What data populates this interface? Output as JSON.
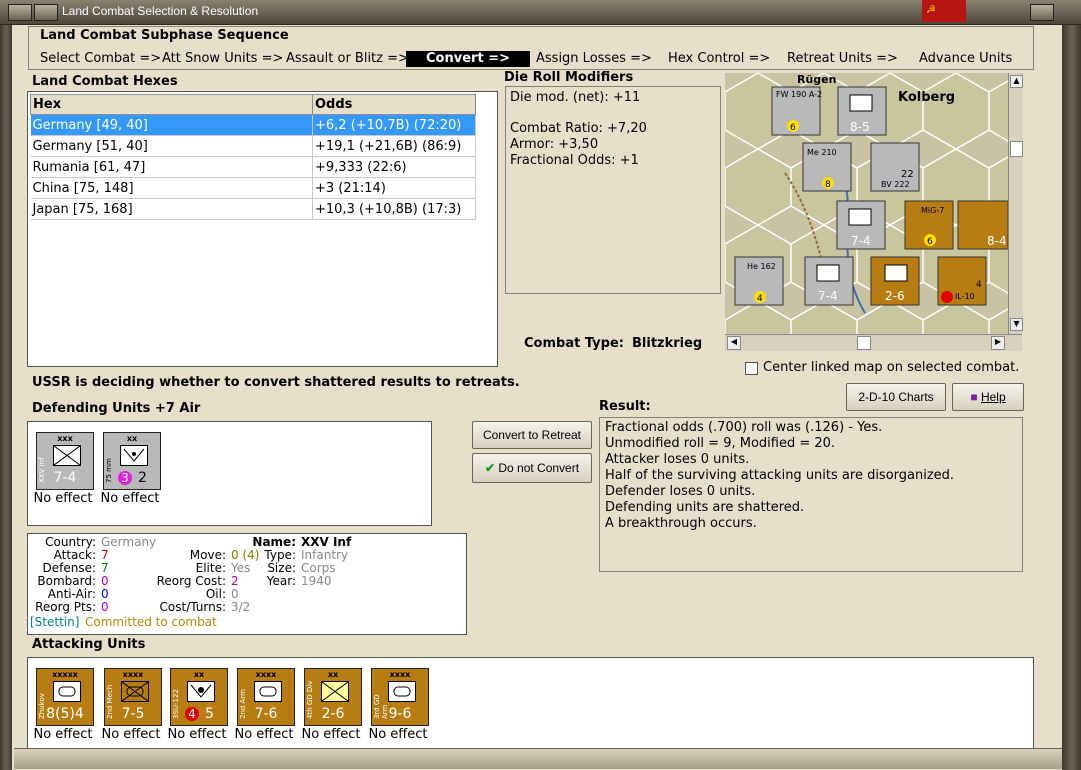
{
  "window": {
    "title": "Land Combat Selection & Resolution"
  },
  "sequence": {
    "title": "Land Combat Subphase Sequence",
    "items": [
      "Select Combat =>",
      "Att Snow Units =>",
      "Assault or Blitz =>",
      "Convert =>",
      "Assign Losses =>",
      "Hex Control =>",
      "Retreat Units =>",
      "Advance Units"
    ]
  },
  "hexes": {
    "title": "Land Combat Hexes",
    "columns": [
      "Hex",
      "Odds"
    ],
    "rows": [
      [
        "Germany [49, 40]",
        "+6,2 (+10,7B) (72:20)"
      ],
      [
        "Germany [51, 40]",
        "+19,1 (+21,6B) (86:9)"
      ],
      [
        "Rumania [61, 47]",
        "+9,333 (22:6)"
      ],
      [
        "China [75, 148]",
        "+3 (21:14)"
      ],
      [
        "Japan [75, 168]",
        "+10,3 (+10,8B) (17:3)"
      ]
    ]
  },
  "modifiers": {
    "title": "Die Roll Modifiers",
    "lines": [
      "Die mod. (net): +11",
      "",
      "Combat Ratio: +7,20",
      "Armor: +3,50",
      "Fractional Odds: +1"
    ]
  },
  "combat_type": {
    "label": "Combat Type:",
    "value": "Blitzkrieg"
  },
  "center_map_label": "Center linked map on selected combat.",
  "status_text": "USSR is deciding whether to convert shattered results to retreats.",
  "buttons": {
    "charts": "2-D-10 Charts",
    "help": "Help",
    "convert": "Convert to Retreat",
    "no_convert": "Do not Convert"
  },
  "defending": {
    "title": "Defending Units +7 Air",
    "units": [
      {
        "size": "xxx",
        "side": "XXV Inf",
        "strength": "7-4",
        "effect": "No effect"
      },
      {
        "size": "xx",
        "side": "75 mm",
        "strength_a": "3",
        "strength_b": "2",
        "effect": "No effect"
      }
    ]
  },
  "unit_info": {
    "country_label": "Country:",
    "country": "Germany",
    "attack_label": "Attack:",
    "attack": "7",
    "defense_label": "Defense:",
    "defense": "7",
    "bombard_label": "Bombard:",
    "bombard": "0",
    "antiair_label": "Anti-Air:",
    "antiair": "0",
    "reorg_pts_label": "Reorg Pts:",
    "reorg_pts": "0",
    "move_label": "Move:",
    "move": "0 (4)",
    "elite_label": "Elite:",
    "elite": "Yes",
    "reorg_cost_label": "Reorg Cost:",
    "reorg_cost": "2",
    "oil_label": "Oil:",
    "oil": "0",
    "cost_turns_label": "Cost/Turns:",
    "cost_turns": "3/2",
    "name_label": "Name:",
    "name": "XXV Inf",
    "type_label": "Type:",
    "type": "Infantry",
    "size_label": "Size:",
    "size": "Corps",
    "year_label": "Year:",
    "year": "1940",
    "location": "[Stettin]",
    "status": "Committed to combat"
  },
  "result": {
    "title": "Result:",
    "lines": [
      "Fractional odds (.700) roll was (.126)  - Yes.",
      "Unmodified roll = 9, Modified = 20.",
      "Attacker loses 0 units.",
      "Half of the surviving attacking units are disorganized.",
      "Defender loses 0 units.",
      "Defending units are shattered.",
      "A breakthrough occurs."
    ]
  },
  "attacking": {
    "title": "Attacking Units",
    "units": [
      {
        "size": "xxxxx",
        "side": "Zhukov",
        "strength": "8(5)4",
        "effect": "No effect"
      },
      {
        "size": "xxxx",
        "side": "2nd Mech",
        "strength": "7-5",
        "effect": "No effect"
      },
      {
        "size": "xx",
        "side": "3SU-122",
        "strength_a": "4",
        "strength_b": "5",
        "effect": "No effect"
      },
      {
        "size": "xxxx",
        "side": "2nd Arm",
        "strength": "7-6",
        "effect": "No effect"
      },
      {
        "size": "xx",
        "side": "4th GD Div",
        "strength": "2-6",
        "effect": "No effect"
      },
      {
        "size": "xxxx",
        "side": "3rd GD Arm",
        "strength": "9-6",
        "effect": "No effect"
      }
    ]
  },
  "map": {
    "labels": [
      "Rügen",
      "Kolberg"
    ],
    "counters": [
      {
        "label": "FW 190 A-2",
        "value": "6"
      },
      {
        "label": "8-5"
      },
      {
        "label": "Me 210",
        "value": "8"
      },
      {
        "label": "BV 222",
        "value": "22"
      },
      {
        "label": "7-4"
      },
      {
        "label": "MiG-7",
        "value": "6"
      },
      {
        "label": "8-4"
      },
      {
        "label": "He 162",
        "value": "4"
      },
      {
        "label": "2-6"
      },
      {
        "label": "IL-10",
        "value": "4"
      }
    ]
  },
  "colors": {
    "frame": "#e8dfcb",
    "selection": "#3399ff",
    "soviet_counter": "#b77d12",
    "german_counter": "#b9b9b9",
    "red_value": "#d00000",
    "purple_value": "#b000b0",
    "grey_value": "#888888",
    "olive_value": "#808000",
    "location": "#008080",
    "status": "#b8860b"
  }
}
